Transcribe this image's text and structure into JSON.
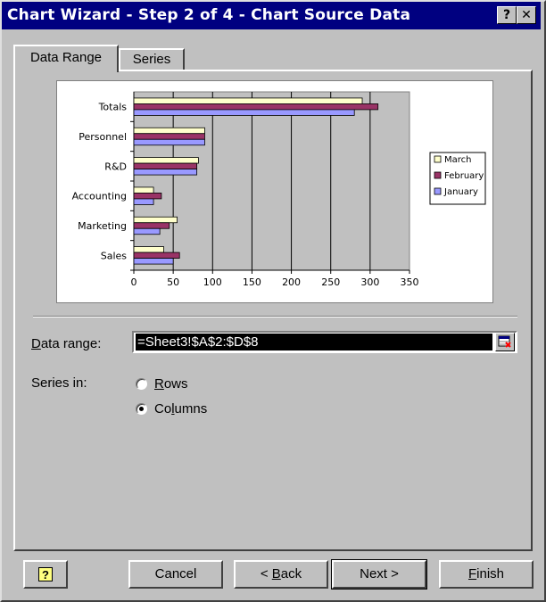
{
  "window": {
    "title": "Chart Wizard - Step 2 of 4 - Chart Source Data",
    "help_glyph": "?",
    "close_glyph": "✕"
  },
  "tabs": [
    {
      "label": "Data Range",
      "active": true
    },
    {
      "label": "Series",
      "active": false
    }
  ],
  "chart_data": {
    "type": "bar",
    "orientation": "horizontal",
    "categories": [
      "Sales",
      "Marketing",
      "Accounting",
      "R&D",
      "Personnel",
      "Totals"
    ],
    "series": [
      {
        "name": "January",
        "color": "#9999ff",
        "values": [
          50,
          33,
          25,
          80,
          90,
          280
        ]
      },
      {
        "name": "February",
        "color": "#993366",
        "values": [
          58,
          45,
          35,
          80,
          90,
          310
        ]
      },
      {
        "name": "March",
        "color": "#ffffcc",
        "values": [
          38,
          55,
          25,
          82,
          90,
          290
        ]
      }
    ],
    "xlim": [
      0,
      350
    ],
    "x_ticks": [
      "0",
      "50",
      "100",
      "150",
      "200",
      "250",
      "300",
      "350"
    ],
    "grid": true,
    "legend": {
      "position": "right",
      "items": [
        "March",
        "February",
        "January"
      ]
    }
  },
  "form": {
    "data_range_label_key": "D",
    "data_range_label_rest": "ata range:",
    "data_range_value": "=Sheet3!$A$2:$D$8",
    "series_in_label": "Series in:",
    "rows_key": "R",
    "rows_rest": "ows",
    "columns_pre": "Co",
    "columns_key": "l",
    "columns_post": "umns",
    "selected": "Columns"
  },
  "buttons": {
    "help_glyph": "?",
    "cancel": "Cancel",
    "back_pre": "< ",
    "back_key": "B",
    "back_post": "ack",
    "next": "Next >",
    "finish_key": "F",
    "finish_post": "inish"
  }
}
